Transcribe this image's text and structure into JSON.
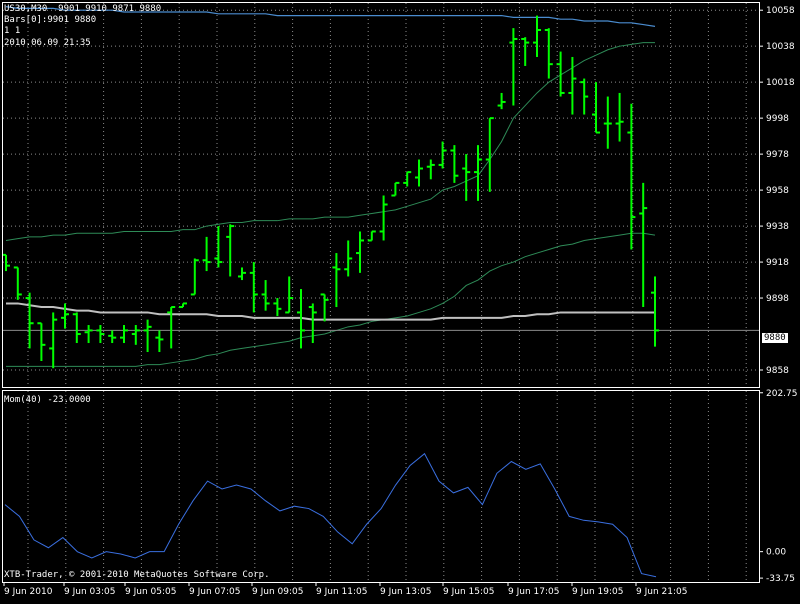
{
  "header": {
    "symbol_line": "US30,M30  9901 9910 9871 9880",
    "bars_line": "Bars[0]:9901 9880",
    "ratio_line": "1 1",
    "datetime_line": "2010.06.09 21:35"
  },
  "indicator_label": "Mom(40) -23.0000",
  "copyright": "XTB-Trader, © 2001-2010 MetaQuotes Software Corp.",
  "current_price_label": "9880",
  "colors": {
    "background": "#000000",
    "grid": "#8a8a8a",
    "bars": "#00ff00",
    "envelope": "#2e8b57",
    "ma": "#c0c0c0",
    "top_band": "#4a8ccf",
    "momentum": "#3a6fe0",
    "axis_text": "#ffffff"
  },
  "chart_data": [
    {
      "type": "ohlc",
      "name": "US30,M30",
      "ylim": [
        9848,
        10062
      ],
      "y_ticks": [
        "10058",
        "10038",
        "10018",
        "9998",
        "9978",
        "9958",
        "9938",
        "9918",
        "9898",
        "9858"
      ],
      "x_ticks": [
        "9 Jun 2010",
        "9 Jun 03:05",
        "9 Jun 05:05",
        "9 Jun 07:05",
        "9 Jun 09:05",
        "9 Jun 11:05",
        "9 Jun 13:05",
        "9 Jun 15:05",
        "9 Jun 17:05",
        "9 Jun 19:05",
        "9 Jun 21:05"
      ],
      "bars": [
        {
          "x": 0,
          "o": 9922,
          "h": 9922,
          "l": 9913,
          "c": 9916
        },
        {
          "x": 1,
          "o": 9915,
          "h": 9915,
          "l": 9897,
          "c": 9900
        },
        {
          "x": 2,
          "o": 9898,
          "h": 9901,
          "l": 9870,
          "c": 9884
        },
        {
          "x": 3,
          "o": 9884,
          "h": 9884,
          "l": 9863,
          "c": 9872
        },
        {
          "x": 4,
          "o": 9870,
          "h": 9890,
          "l": 9859,
          "c": 9886
        },
        {
          "x": 5,
          "o": 9887,
          "h": 9895,
          "l": 9881,
          "c": 9889
        },
        {
          "x": 6,
          "o": 9889,
          "h": 9890,
          "l": 9873,
          "c": 9878
        },
        {
          "x": 7,
          "o": 9879,
          "h": 9883,
          "l": 9873,
          "c": 9880
        },
        {
          "x": 8,
          "o": 9880,
          "h": 9883,
          "l": 9873,
          "c": 9878
        },
        {
          "x": 9,
          "o": 9877,
          "h": 9880,
          "l": 9873,
          "c": 9876
        },
        {
          "x": 10,
          "o": 9876,
          "h": 9883,
          "l": 9873,
          "c": 9880
        },
        {
          "x": 11,
          "o": 9878,
          "h": 9883,
          "l": 9872,
          "c": 9880
        },
        {
          "x": 12,
          "o": 9880,
          "h": 9886,
          "l": 9868,
          "c": 9882
        },
        {
          "x": 13,
          "o": 9876,
          "h": 9880,
          "l": 9868,
          "c": 9875
        },
        {
          "x": 14,
          "o": 9890,
          "h": 9893,
          "l": 9870,
          "c": 9893
        },
        {
          "x": 15,
          "o": 9893,
          "h": 9895,
          "l": 9893,
          "c": 9895
        },
        {
          "x": 16,
          "o": 9900,
          "h": 9920,
          "l": 9900,
          "c": 9919
        },
        {
          "x": 17,
          "o": 9919,
          "h": 9932,
          "l": 9913,
          "c": 9918
        },
        {
          "x": 18,
          "o": 9920,
          "h": 9938,
          "l": 9915,
          "c": 9918
        },
        {
          "x": 19,
          "o": 9932,
          "h": 9939,
          "l": 9910,
          "c": 9938
        },
        {
          "x": 20,
          "o": 9910,
          "h": 9915,
          "l": 9908,
          "c": 9912
        },
        {
          "x": 21,
          "o": 9912,
          "h": 9918,
          "l": 9890,
          "c": 9900
        },
        {
          "x": 22,
          "o": 9900,
          "h": 9908,
          "l": 9891,
          "c": 9895
        },
        {
          "x": 23,
          "o": 9895,
          "h": 9898,
          "l": 9888,
          "c": 9892
        },
        {
          "x": 24,
          "o": 9890,
          "h": 9910,
          "l": 9890,
          "c": 9898
        },
        {
          "x": 25,
          "o": 9890,
          "h": 9903,
          "l": 9870,
          "c": 9880
        },
        {
          "x": 26,
          "o": 9893,
          "h": 9895,
          "l": 9873,
          "c": 9890
        },
        {
          "x": 27,
          "o": 9900,
          "h": 9900,
          "l": 9885,
          "c": 9897
        },
        {
          "x": 28,
          "o": 9915,
          "h": 9923,
          "l": 9893,
          "c": 9914
        },
        {
          "x": 29,
          "o": 9914,
          "h": 9930,
          "l": 9910,
          "c": 9920
        },
        {
          "x": 30,
          "o": 9923,
          "h": 9935,
          "l": 9912,
          "c": 9930
        },
        {
          "x": 31,
          "o": 9930,
          "h": 9935,
          "l": 9930,
          "c": 9935
        },
        {
          "x": 32,
          "o": 9935,
          "h": 9955,
          "l": 9930,
          "c": 9950
        },
        {
          "x": 33,
          "o": 9955,
          "h": 9962,
          "l": 9955,
          "c": 9962
        },
        {
          "x": 34,
          "o": 9962,
          "h": 9968,
          "l": 9960,
          "c": 9968
        },
        {
          "x": 35,
          "o": 9965,
          "h": 9975,
          "l": 9960,
          "c": 9970
        },
        {
          "x": 36,
          "o": 9971,
          "h": 9975,
          "l": 9964,
          "c": 9972
        },
        {
          "x": 37,
          "o": 9972,
          "h": 9985,
          "l": 9970,
          "c": 9980
        },
        {
          "x": 38,
          "o": 9980,
          "h": 9983,
          "l": 9962,
          "c": 9966
        },
        {
          "x": 39,
          "o": 9970,
          "h": 9978,
          "l": 9952,
          "c": 9968
        },
        {
          "x": 40,
          "o": 9968,
          "h": 9983,
          "l": 9952,
          "c": 9975
        },
        {
          "x": 41,
          "o": 9975,
          "h": 9998,
          "l": 9957,
          "c": 9998
        },
        {
          "x": 42,
          "o": 10005,
          "h": 10012,
          "l": 10003,
          "c": 10007
        },
        {
          "x": 43,
          "o": 10040,
          "h": 10048,
          "l": 10005,
          "c": 10042
        },
        {
          "x": 44,
          "o": 10042,
          "h": 10043,
          "l": 10027,
          "c": 10040
        },
        {
          "x": 45,
          "o": 10040,
          "h": 10055,
          "l": 10032,
          "c": 10047
        },
        {
          "x": 46,
          "o": 10047,
          "h": 10048,
          "l": 10020,
          "c": 10028
        },
        {
          "x": 47,
          "o": 10028,
          "h": 10035,
          "l": 10010,
          "c": 10012
        },
        {
          "x": 48,
          "o": 10012,
          "h": 10032,
          "l": 10000,
          "c": 10020
        },
        {
          "x": 49,
          "o": 10018,
          "h": 10020,
          "l": 10000,
          "c": 10010
        },
        {
          "x": 50,
          "o": 10000,
          "h": 10018,
          "l": 9990,
          "c": 9990
        },
        {
          "x": 51,
          "o": 9995,
          "h": 10010,
          "l": 9981,
          "c": 9995
        },
        {
          "x": 52,
          "o": 9995,
          "h": 10012,
          "l": 9985,
          "c": 9996
        },
        {
          "x": 53,
          "o": 9990,
          "h": 10006,
          "l": 9925,
          "c": 9943
        },
        {
          "x": 54,
          "o": 9945,
          "h": 9962,
          "l": 9893,
          "c": 9948
        },
        {
          "x": 55,
          "o": 9901,
          "h": 9910,
          "l": 9871,
          "c": 9880
        }
      ],
      "ma_line": [
        9895,
        9895,
        9894,
        9893,
        9893,
        9892,
        9891,
        9891,
        9890,
        9890,
        9890,
        9890,
        9890,
        9889,
        9889,
        9889,
        9889,
        9889,
        9888,
        9888,
        9888,
        9887,
        9887,
        9887,
        9887,
        9887,
        9886,
        9886,
        9886,
        9886,
        9886,
        9886,
        9886,
        9886,
        9886,
        9886,
        9886,
        9887,
        9887,
        9887,
        9887,
        9887,
        9887,
        9888,
        9888,
        9889,
        9889,
        9890,
        9890,
        9890,
        9890,
        9890,
        9890,
        9890,
        9890,
        9890
      ],
      "upper_envelope": [
        9930,
        9931,
        9932,
        9932,
        9933,
        9933,
        9934,
        9934,
        9934,
        9934,
        9935,
        9935,
        9935,
        9935,
        9935,
        9936,
        9936,
        9938,
        9939,
        9940,
        9940,
        9941,
        9941,
        9941,
        9942,
        9942,
        9942,
        9943,
        9943,
        9943,
        9944,
        9945,
        9946,
        9947,
        9949,
        9951,
        9953,
        9958,
        9960,
        9963,
        9966,
        9975,
        9985,
        9998,
        10005,
        10012,
        10018,
        10022,
        10026,
        10030,
        10033,
        10036,
        10038,
        10039,
        10040,
        10040
      ],
      "lower_envelope": [
        9860,
        9860,
        9860,
        9860,
        9860,
        9860,
        9860,
        9860,
        9860,
        9860,
        9860,
        9860,
        9861,
        9861,
        9862,
        9863,
        9864,
        9866,
        9867,
        9869,
        9870,
        9871,
        9872,
        9873,
        9874,
        9876,
        9877,
        9878,
        9880,
        9882,
        9883,
        9885,
        9886,
        9887,
        9888,
        9890,
        9892,
        9895,
        9899,
        9905,
        9908,
        9913,
        9916,
        9918,
        9921,
        9923,
        9925,
        9927,
        9928,
        9930,
        9931,
        9932,
        9933,
        9934,
        9934,
        9933
      ],
      "top_band": [
        10060,
        10059,
        10059,
        10059,
        10059,
        10058,
        10058,
        10058,
        10058,
        10058,
        10057,
        10057,
        10057,
        10057,
        10057,
        10057,
        10057,
        10057,
        10056,
        10056,
        10056,
        10056,
        10056,
        10055,
        10055,
        10055,
        10055,
        10055,
        10055,
        10055,
        10055,
        10055,
        10055,
        10055,
        10055,
        10055,
        10055,
        10055,
        10055,
        10055,
        10055,
        10055,
        10055,
        10054,
        10054,
        10054,
        10054,
        10053,
        10053,
        10052,
        10052,
        10052,
        10051,
        10051,
        10050,
        10049
      ]
    },
    {
      "type": "line",
      "name": "Mom(40)",
      "ylim": [
        -40,
        205
      ],
      "y_ticks": [
        "202.75",
        "0.00",
        "-33.75"
      ],
      "values": [
        60,
        45,
        15,
        5,
        18,
        0,
        -8,
        0,
        -3,
        -8,
        0,
        0,
        35,
        65,
        90,
        80,
        85,
        80,
        65,
        52,
        58,
        55,
        45,
        25,
        10,
        35,
        55,
        85,
        110,
        125,
        90,
        75,
        82,
        60,
        100,
        115,
        105,
        112,
        80,
        45,
        40,
        38,
        35,
        18,
        -28,
        -32
      ]
    }
  ]
}
